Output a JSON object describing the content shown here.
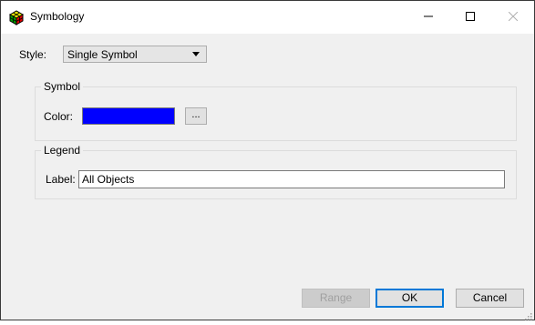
{
  "window": {
    "title": "Symbology",
    "controls": {
      "minimize": "minimize",
      "maximize": "maximize",
      "close": "close"
    }
  },
  "style": {
    "label": "Style:",
    "selected": "Single Symbol"
  },
  "symbol_group": {
    "title": "Symbol",
    "color_label": "Color:",
    "color_value": "#0000ff",
    "browse_label": "..."
  },
  "legend_group": {
    "title": "Legend",
    "label_label": "Label:",
    "label_value": "All Objects"
  },
  "buttons": {
    "range": "Range",
    "ok": "OK",
    "cancel": "Cancel"
  },
  "colors": {
    "accent": "#0078d7",
    "swatch": "#0000ff"
  }
}
